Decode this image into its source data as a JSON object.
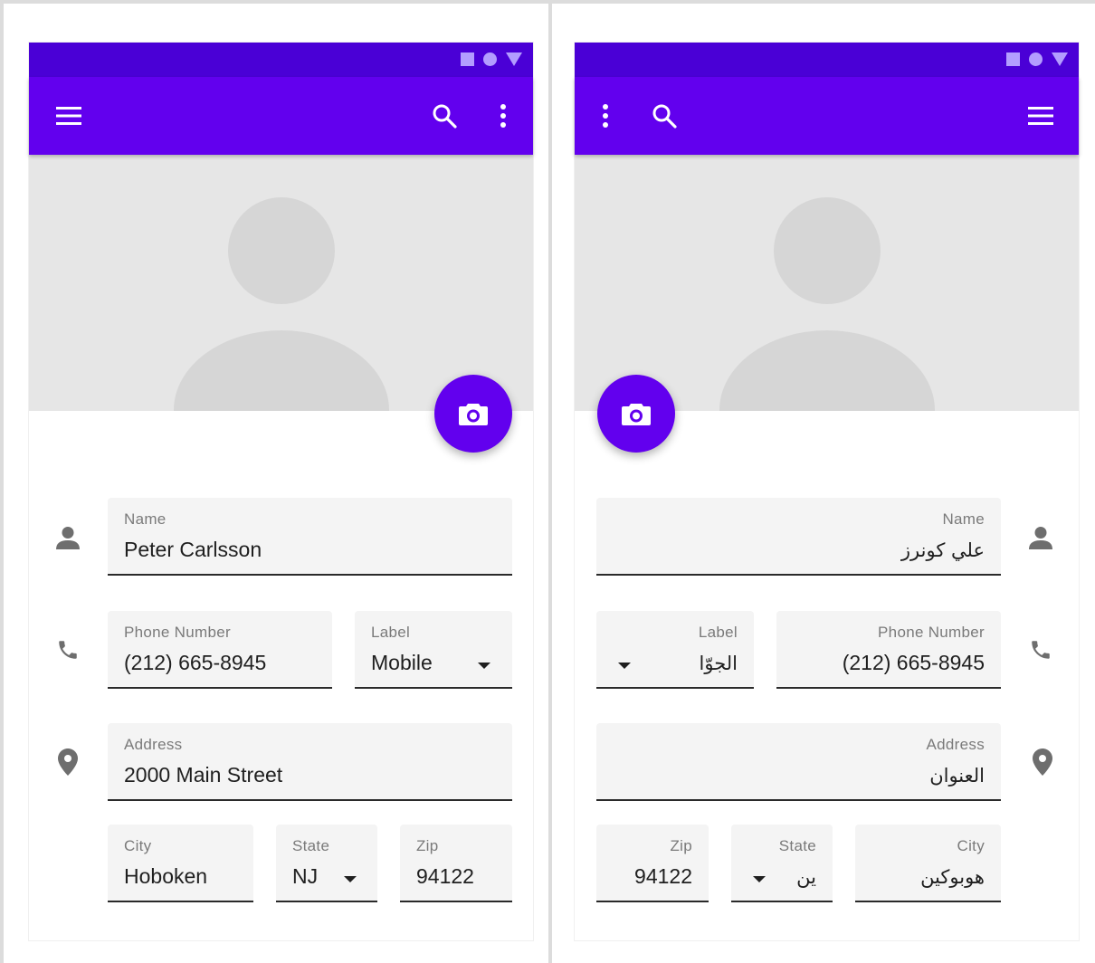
{
  "colors": {
    "status_bar": "#4a00d6",
    "app_bar": "#6200ee",
    "status_icons": "#b39dff",
    "hero_bg": "#e6e6e6",
    "field_bg": "#f4f4f4"
  },
  "ltr": {
    "app_bar": {
      "icons": [
        "menu-icon",
        "search-icon",
        "more-vert-icon"
      ]
    },
    "name": {
      "label": "Name",
      "value": "Peter Carlsson"
    },
    "phone": {
      "label": "Phone Number",
      "value": "(212) 665-8945"
    },
    "phone_label": {
      "label": "Label",
      "value": "Mobile"
    },
    "address": {
      "label": "Address",
      "value": "2000 Main Street"
    },
    "city": {
      "label": "City",
      "value": "Hoboken"
    },
    "state": {
      "label": "State",
      "value": "NJ"
    },
    "zip": {
      "label": "Zip",
      "value": "94122"
    }
  },
  "rtl": {
    "app_bar": {
      "icons": [
        "more-vert-icon",
        "search-icon",
        "menu-icon"
      ]
    },
    "name": {
      "label": "Name",
      "value": "علي كونرز"
    },
    "phone": {
      "label": "Phone Number",
      "value": "(212) 665-8945"
    },
    "phone_label": {
      "label": "Label",
      "value": "الجوّا"
    },
    "address": {
      "label": "Address",
      "value": "العنوان"
    },
    "city": {
      "label": "City",
      "value": "هوبوكين"
    },
    "state": {
      "label": "State",
      "value": "ين"
    },
    "zip": {
      "label": "Zip",
      "value": "94122"
    }
  }
}
